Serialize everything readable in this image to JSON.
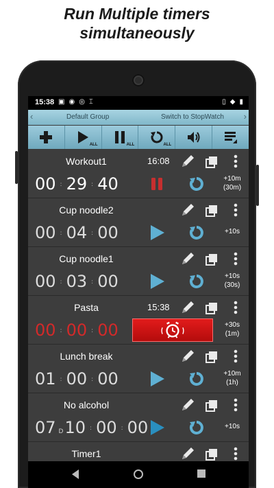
{
  "headline": {
    "line1": "Run Multiple timers",
    "line2": "simultaneously"
  },
  "statusbar": {
    "time": "15:38"
  },
  "group_bar": {
    "left_arrow": "‹",
    "right_arrow": "›",
    "group": "Default Group",
    "switch": "Switch to StopWatch"
  },
  "toolbar": {
    "all_label": "ALL"
  },
  "timers": [
    {
      "name": "Workout1",
      "end_time": "16:08",
      "hh": "00",
      "mm": "29",
      "ss": "40",
      "state": "running",
      "increment": "+10m",
      "increment2": "(30m)"
    },
    {
      "name": "Cup noodle2",
      "end_time": "",
      "hh": "00",
      "mm": "04",
      "ss": "00",
      "state": "stopped",
      "increment": "+10s",
      "increment2": ""
    },
    {
      "name": "Cup noodle1",
      "end_time": "",
      "hh": "00",
      "mm": "03",
      "ss": "00",
      "state": "stopped",
      "increment": "+10s",
      "increment2": "(30s)"
    },
    {
      "name": "Pasta",
      "end_time": "15:38",
      "hh": "00",
      "mm": "00",
      "ss": "00",
      "state": "alarm",
      "increment": "+30s",
      "increment2": "(1m)"
    },
    {
      "name": "Lunch break",
      "end_time": "",
      "hh": "01",
      "mm": "00",
      "ss": "00",
      "state": "stopped",
      "increment": "+10m",
      "increment2": "(1h)"
    },
    {
      "name": "No alcohol",
      "end_time": "",
      "days": "07",
      "day_label": "D",
      "hh": "10",
      "mm": "00",
      "ss": "00",
      "state": "stopped-dark",
      "increment": "+10s",
      "increment2": ""
    },
    {
      "name": "Timer1",
      "end_time": "",
      "hh": "",
      "mm": "",
      "ss": "",
      "state": "partial",
      "increment": "",
      "increment2": ""
    }
  ],
  "colors": {
    "accent": "#8cc3d6",
    "timer_red": "#d22a2a",
    "alarm_bg": "#d01414",
    "play": "#5fb0d3"
  }
}
